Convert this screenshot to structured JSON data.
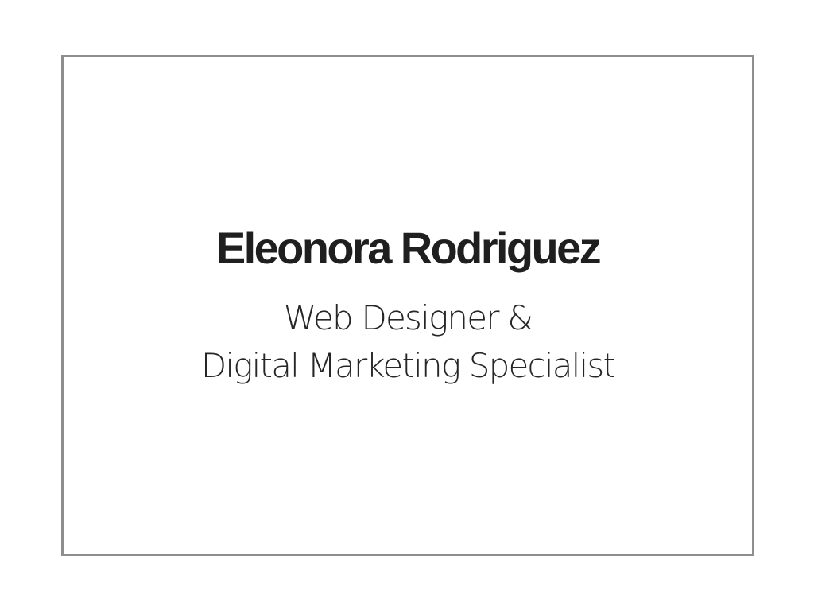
{
  "card": {
    "name": "Eleonora Rodriguez",
    "title_lines": [
      "Web Designer &",
      "Digital Marketing Specialist"
    ]
  },
  "colors": {
    "background": "#ffffff",
    "border": "#8e8e8e",
    "text": "#1f1f1f"
  }
}
